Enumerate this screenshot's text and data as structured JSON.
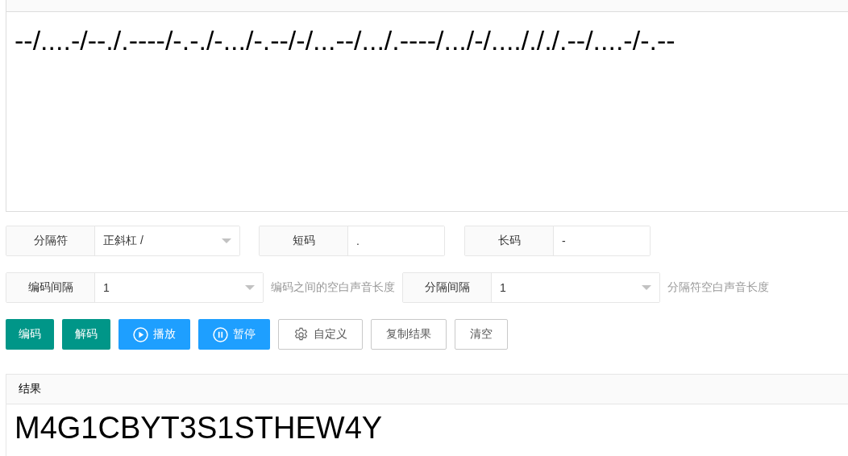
{
  "input": {
    "value": "--/....-/--./.----/-.-./-.../-.--/-/...--/.../.----/.../-/..../././.--/....-/-.--"
  },
  "options_row_1": [
    {
      "label": "分隔符",
      "value": "正斜杠 /",
      "kind": "select"
    },
    {
      "label": "短码",
      "value": ".",
      "kind": "input"
    },
    {
      "label": "长码",
      "value": "-",
      "kind": "input"
    }
  ],
  "options_row_2": [
    {
      "label": "编码间隔",
      "value": "1",
      "kind": "select",
      "hint": "编码之间的空白声音长度"
    },
    {
      "label": "分隔间隔",
      "value": "1",
      "kind": "select",
      "hint": "分隔符空白声音长度"
    }
  ],
  "buttons": [
    {
      "label": "编码",
      "kind": "green"
    },
    {
      "label": "解码",
      "kind": "green"
    },
    {
      "label": "播放",
      "kind": "play"
    },
    {
      "label": "暂停",
      "kind": "pause"
    },
    {
      "label": "自定义",
      "kind": "gear"
    },
    {
      "label": "复制结果",
      "kind": "plain"
    },
    {
      "label": "清空",
      "kind": "plain"
    }
  ],
  "result": {
    "title": "结果",
    "value": "M4G1CBYT3S1STHEW4Y"
  }
}
